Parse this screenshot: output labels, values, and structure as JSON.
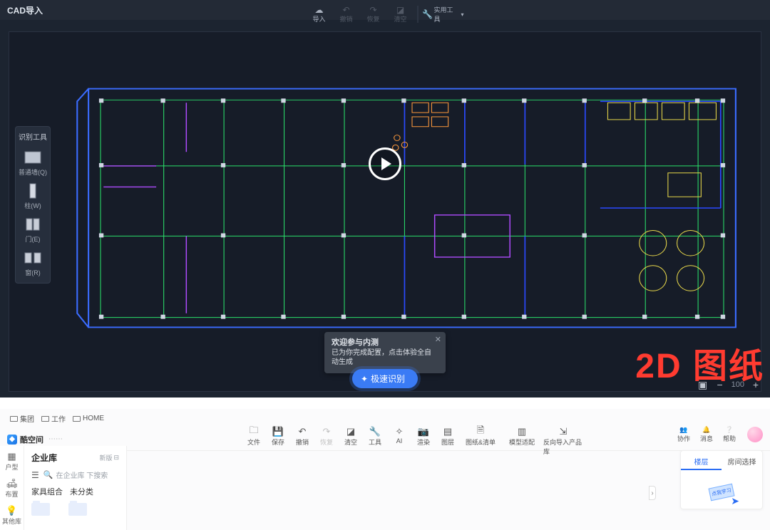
{
  "cad": {
    "title": "CAD导入",
    "toolbar": {
      "import": "导入",
      "undo": "撤销",
      "redo": "恢复",
      "clear": "清空",
      "tools": "实用工具"
    },
    "palette": {
      "title": "识别工具",
      "wall": "普通墙(Q)",
      "column": "柱(W)",
      "door": "门(E)",
      "window": "窗(R)"
    },
    "popup": {
      "title": "欢迎参与内测",
      "body": "已为你完成配置，点击体验全自动生成"
    },
    "cta": "极速识别",
    "watermark": "2D 图纸",
    "zoom": "100"
  },
  "light": {
    "crumbs": {
      "c1": "集团",
      "c2": "工作",
      "c3": "HOME"
    },
    "brand": {
      "name": "酷空间",
      "sub": "⋯⋯"
    },
    "tools": {
      "file": "文件",
      "save": "保存",
      "undo": "撤销",
      "redo": "恢复",
      "clear": "清空",
      "tool": "工具",
      "ai": "AI",
      "render": "渲染",
      "layer": "图层",
      "list": "图纸&清单",
      "match": "模型适配",
      "reverse": "反向导入产品库"
    },
    "right": {
      "collab": "协作",
      "msg": "消息",
      "help": "帮助"
    },
    "rail": {
      "hx": "户型",
      "bj": "布置",
      "jzk": "其他库"
    },
    "lib": {
      "title": "企业库",
      "version": "新版",
      "search_placeholder": "在企业库 下搜索",
      "tab1": "家具组合",
      "tab2": "未分类"
    },
    "mini": {
      "tab1": "楼层",
      "tab2": "房间选择",
      "preview_label": "点我学习"
    }
  }
}
